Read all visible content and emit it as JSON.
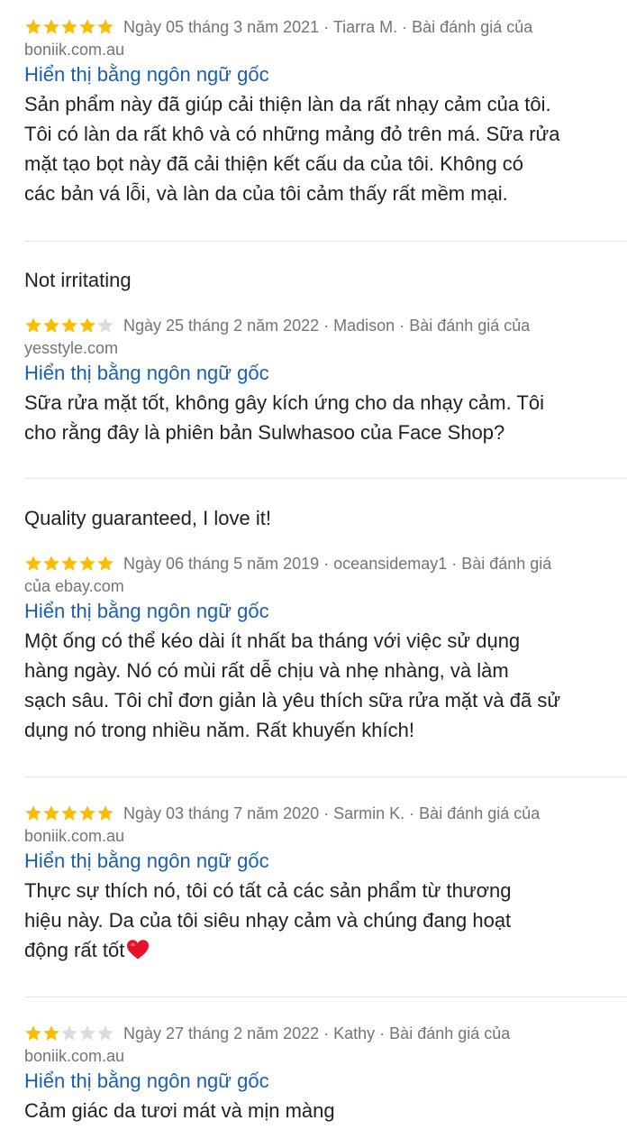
{
  "colors": {
    "star_filled": "#fbbc04",
    "star_empty": "#dadce0",
    "link": "#1a5fb4",
    "meta": "#70757a",
    "text": "#202124",
    "heart": "#e8112d"
  },
  "reviews": [
    {
      "title": "",
      "rating": 5,
      "meta": "Ngày 05 tháng 3 năm 2021 · Tiarra M. · Bài đánh giá của",
      "source": "boniik.com.au",
      "translate_link": "Hiển thị bằng ngôn ngữ gốc",
      "lines": [
        "Sản phẩm này đã giúp cải thiện làn da rất nhạy cảm của tôi.",
        "Tôi có làn da rất khô và có những mảng đỏ trên má. Sữa rửa",
        "mặt tạo bọt này đã cải thiện kết cấu da của tôi. Không có",
        "các bản vá lỗi, và làn da của tôi cảm thấy rất mềm mại."
      ]
    },
    {
      "title": "Not irritating",
      "rating": 4,
      "meta": "Ngày 25 tháng 2 năm 2022 · Madison · Bài đánh giá của",
      "source": "yesstyle.com",
      "translate_link": "Hiển thị bằng ngôn ngữ gốc",
      "lines": [
        "Sữa rửa mặt tốt, không gây kích ứng cho da nhạy cảm. Tôi",
        "cho rằng đây là phiên bản Sulwhasoo của Face Shop?"
      ]
    },
    {
      "title": "Quality guaranteed, I love it!",
      "rating": 5,
      "meta": "Ngày 06 tháng 5 năm 2019 · oceansidemay1 · Bài đánh giá",
      "source": "của ebay.com",
      "translate_link": "Hiển thị bằng ngôn ngữ gốc",
      "lines": [
        "Một ống có thể kéo dài ít nhất ba tháng với việc sử dụng",
        "hàng ngày. Nó có mùi rất dễ chịu và nhẹ nhàng, và làm",
        "sạch sâu. Tôi chỉ đơn giản là yêu thích sữa rửa mặt và đã sử",
        "dụng nó trong nhiều năm. Rất khuyến khích!"
      ]
    },
    {
      "title": "",
      "rating": 5,
      "meta": "Ngày 03 tháng 7 năm 2020 · Sarmin K. · Bài đánh giá của",
      "source": "boniik.com.au",
      "translate_link": "Hiển thị bằng ngôn ngữ gốc",
      "lines": [
        "Thực sự thích nó, tôi có tất cả các sản phẩm từ thương",
        "hiệu này. Da của tôi siêu nhạy cảm và chúng đang hoạt",
        "động rất tốt"
      ],
      "trailing_icon": "red-heart-icon"
    },
    {
      "title": "",
      "rating": 2,
      "meta": "Ngày 27 tháng 2 năm 2022 · Kathy · Bài đánh giá của",
      "source": "boniik.com.au",
      "translate_link": "Hiển thị bằng ngôn ngữ gốc",
      "lines": [
        "Cảm giác da tươi mát và mịn màng"
      ]
    }
  ]
}
